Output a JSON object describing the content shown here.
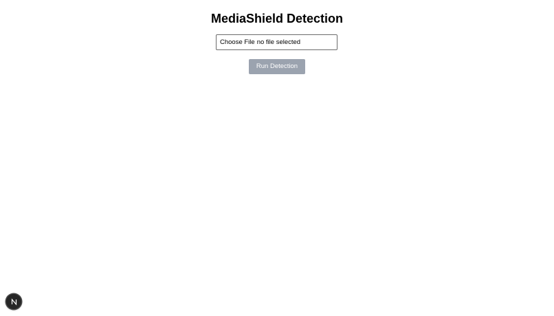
{
  "page": {
    "title": "MediaShield Detection"
  },
  "upload": {
    "choose_label": "Choose File",
    "status": "no file selected"
  },
  "actions": {
    "run_label": "Run Detection",
    "run_disabled": true
  },
  "dev_indicator": {
    "icon": "nextjs-logo-icon",
    "letter": "N"
  },
  "colors": {
    "run_button_bg": "#9ba3af",
    "indicator_bg": "#262626"
  }
}
